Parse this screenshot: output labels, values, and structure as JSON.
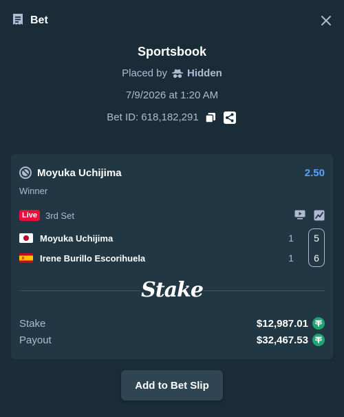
{
  "header": {
    "title": "Bet"
  },
  "meta": {
    "heading": "Sportsbook",
    "placed_by_label": "Placed by",
    "placed_by_user": "Hidden",
    "date": "7/9/2026 at 1:20 AM",
    "bet_id": "Bet ID: 618,182,291"
  },
  "selection": {
    "name": "Moyuka Uchijima",
    "odds": "2.50",
    "market": "Winner",
    "live_label": "Live",
    "period": "3rd Set"
  },
  "players": [
    {
      "name": "Moyuka Uchijima",
      "set_score": "1",
      "game_score": "5",
      "flag": "japan-flag-icon"
    },
    {
      "name": "Irene Burillo Escorihuela",
      "set_score": "1",
      "game_score": "6",
      "flag": "spain-flag-icon"
    }
  ],
  "brand": {
    "logo": "Stake"
  },
  "summary": {
    "stake_label": "Stake",
    "stake_value": "$12,987.01",
    "payout_label": "Payout",
    "payout_value": "$32,467.53",
    "currency_icon": "tether-icon"
  },
  "actions": {
    "add_to_slip": "Add to Bet Slip"
  },
  "colors": {
    "background": "#1a2c38",
    "card": "#213743",
    "button": "#2f4553",
    "odds": "#5aa0ff",
    "live": "#e9113c",
    "currency": "#1ea672"
  }
}
